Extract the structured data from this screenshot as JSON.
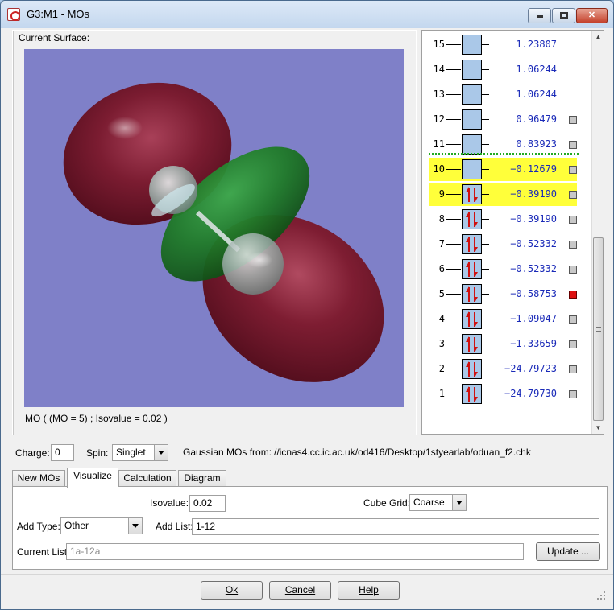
{
  "window": {
    "title": "G3:M1 - MOs"
  },
  "surface": {
    "label": "Current Surface:",
    "caption": "MO ( (MO = 5) ; Isovalue = 0.02 )",
    "background_color": "#7f80c8",
    "lobe_colors": {
      "positive": "#7a1a2e",
      "negative": "#1f7a26"
    }
  },
  "mo_list": {
    "rows": [
      {
        "num": "15",
        "energy": "1.23807",
        "occupied": false,
        "highlight": false,
        "check": ""
      },
      {
        "num": "14",
        "energy": "1.06244",
        "occupied": false,
        "highlight": false,
        "check": ""
      },
      {
        "num": "13",
        "energy": "1.06244",
        "occupied": false,
        "highlight": false,
        "check": ""
      },
      {
        "num": "12",
        "energy": "0.96479",
        "occupied": false,
        "highlight": false,
        "check": "gray"
      },
      {
        "num": "11",
        "energy": "0.83923",
        "occupied": false,
        "highlight": false,
        "check": "gray"
      },
      {
        "num": "10",
        "energy": "−0.12679",
        "occupied": false,
        "highlight": true,
        "check": "gray"
      },
      {
        "num": "9",
        "energy": "−0.39190",
        "occupied": true,
        "highlight": true,
        "check": "gray"
      },
      {
        "num": "8",
        "energy": "−0.39190",
        "occupied": true,
        "highlight": false,
        "check": "gray"
      },
      {
        "num": "7",
        "energy": "−0.52332",
        "occupied": true,
        "highlight": false,
        "check": "gray"
      },
      {
        "num": "6",
        "energy": "−0.52332",
        "occupied": true,
        "highlight": false,
        "check": "gray"
      },
      {
        "num": "5",
        "energy": "−0.58753",
        "occupied": true,
        "highlight": false,
        "check": "red"
      },
      {
        "num": "4",
        "energy": "−1.09047",
        "occupied": true,
        "highlight": false,
        "check": "gray"
      },
      {
        "num": "3",
        "energy": "−1.33659",
        "occupied": true,
        "highlight": false,
        "check": "gray"
      },
      {
        "num": "2",
        "energy": "−24.79723",
        "occupied": true,
        "highlight": false,
        "check": "gray"
      },
      {
        "num": "1",
        "energy": "−24.79730",
        "occupied": true,
        "highlight": false,
        "check": "gray"
      }
    ]
  },
  "controls": {
    "charge_label": "Charge:",
    "charge_value": "0",
    "spin_label": "Spin:",
    "spin_value": "Singlet",
    "source_label": "Gaussian MOs from:",
    "source_path": "//icnas4.cc.ic.ac.uk/od416/Desktop/1styearlab/oduan_f2.chk"
  },
  "tabs": [
    {
      "label": "New MOs",
      "active": false
    },
    {
      "label": "Visualize",
      "active": true
    },
    {
      "label": "Calculation",
      "active": false
    },
    {
      "label": "Diagram",
      "active": false
    }
  ],
  "visualize": {
    "isovalue_label": "Isovalue:",
    "isovalue": "0.02",
    "cube_grid_label": "Cube Grid:",
    "cube_grid": "Coarse",
    "add_type_label": "Add Type:",
    "add_type": "Other",
    "add_list_label": "Add List:",
    "add_list": "1-12",
    "current_list_label": "Current List:",
    "current_list": "1a-12a",
    "update_label": "Update ..."
  },
  "footer": {
    "ok": "Ok",
    "cancel": "Cancel",
    "help": "Help"
  }
}
